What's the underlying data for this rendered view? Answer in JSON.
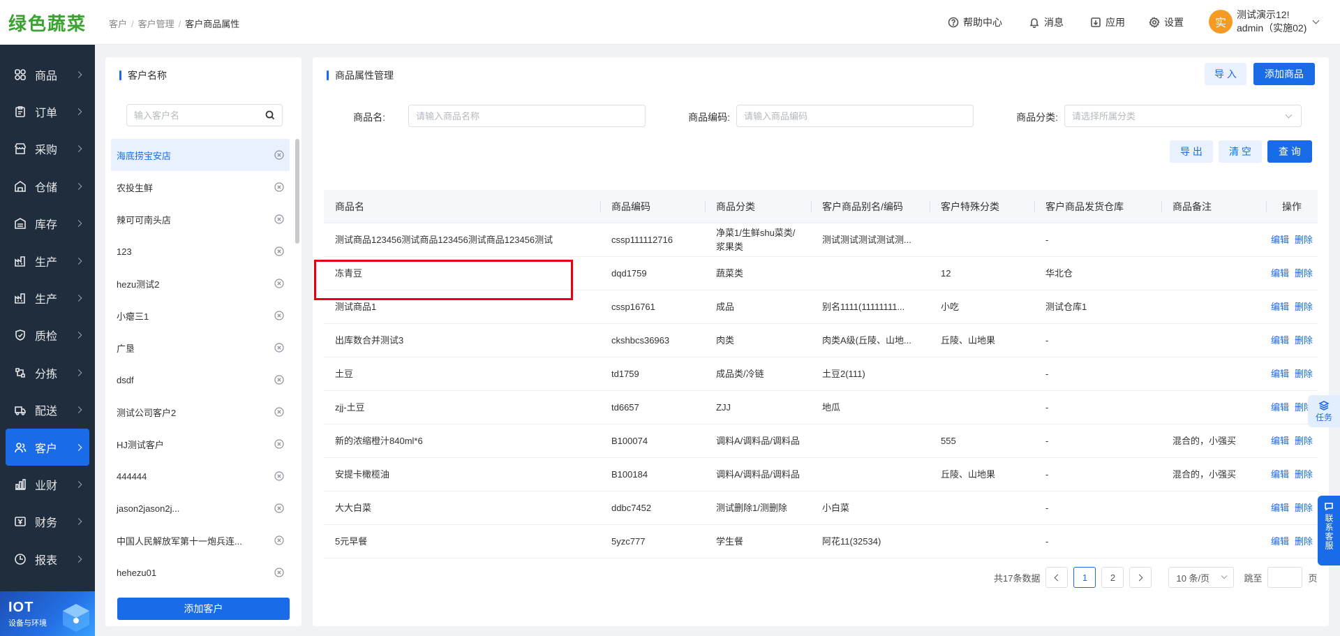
{
  "logo": {
    "text": "绿色蔬菜"
  },
  "sidebar": {
    "items": [
      {
        "label": "商品",
        "icon": "grid-icon"
      },
      {
        "label": "订单",
        "icon": "clipboard-icon"
      },
      {
        "label": "采购",
        "icon": "shop-icon"
      },
      {
        "label": "仓储",
        "icon": "warehouse-icon"
      },
      {
        "label": "库存",
        "icon": "inventory-icon"
      },
      {
        "label": "生产",
        "icon": "factory-icon"
      },
      {
        "label": "生产",
        "icon": "factory-icon"
      },
      {
        "label": "质检",
        "icon": "shield-icon"
      },
      {
        "label": "分拣",
        "icon": "sort-icon"
      },
      {
        "label": "配送",
        "icon": "truck-icon"
      },
      {
        "label": "客户",
        "icon": "user-icon"
      },
      {
        "label": "业财",
        "icon": "finance-icon"
      },
      {
        "label": "财务",
        "icon": "money-icon"
      },
      {
        "label": "报表",
        "icon": "report-icon"
      }
    ],
    "active_index": 10,
    "iot": {
      "title": "IOT",
      "subtitle": "设备与环境"
    }
  },
  "header": {
    "breadcrumb": [
      "客户",
      "客户管理",
      "客户商品属性"
    ],
    "help": "帮助中心",
    "messages": "消息",
    "apps": "应用",
    "settings": "设置",
    "avatar_char": "实",
    "user_name": "测试演示12!",
    "user_account": "admin（实施02)"
  },
  "customer_panel": {
    "title": "客户名称",
    "search_placeholder": "输入客户名",
    "customers": [
      "海底捞宝安店",
      "农投生鲜",
      "辣可可南头店",
      "123",
      "hezu测试2",
      "小瘪三1",
      "广垦",
      "dsdf",
      "测试公司客户2",
      "HJ测试客户",
      "444444",
      "jason2jason2j...",
      "中国人民解放军第十一炮兵连...",
      "hehezu01"
    ],
    "selected_index": 0,
    "add_button": "添加客户"
  },
  "main": {
    "title": "商品属性管理",
    "import_button": "导 入",
    "add_product_button": "添加商品",
    "filters": {
      "name_label": "商品名:",
      "name_placeholder": "请输入商品名称",
      "code_label": "商品编码:",
      "code_placeholder": "请输入商品编码",
      "category_label": "商品分类:",
      "category_placeholder": "请选择所属分类"
    },
    "export_button": "导 出",
    "clear_button": "清 空",
    "query_button": "查 询",
    "table": {
      "columns": [
        "商品名",
        "商品编码",
        "商品分类",
        "客户商品别名/编码",
        "客户特殊分类",
        "客户商品发货仓库",
        "商品备注",
        "操作"
      ],
      "edit_label": "编辑",
      "delete_label": "删除",
      "rows": [
        [
          "测试商品123456测试商品123456测试商品123456测试",
          "cssp111112716",
          "净菜1/生鲜shu菜类/浆果类",
          "测试测试测试测试测...",
          "",
          "-",
          ""
        ],
        [
          "冻青豆",
          "dqd1759",
          "蔬菜类",
          "",
          "12",
          "华北仓",
          ""
        ],
        [
          "测试商品1",
          "cssp16761",
          "成品",
          "别名1111(11111111...",
          "小吃",
          "测试仓库1",
          ""
        ],
        [
          "出库数合并测试3",
          "ckshbcs36963",
          "肉类",
          "肉类A级(丘陵、山地...",
          "丘陵、山地果",
          "-",
          ""
        ],
        [
          "土豆",
          "td1759",
          "成品类/冷链",
          "土豆2(111)",
          "",
          "-",
          ""
        ],
        [
          "zjj-土豆",
          "td6657",
          "ZJJ",
          "地瓜",
          "",
          "-",
          ""
        ],
        [
          "新的浓缩橙汁840ml*6",
          "B100074",
          "调料A/调料品/调料品",
          "",
          "555",
          "-",
          "混合的，小强买"
        ],
        [
          "安提卡橄榄油",
          "B100184",
          "调料A/调料品/调料品",
          "",
          "丘陵、山地果",
          "-",
          "混合的，小强买"
        ],
        [
          "大大白菜",
          "ddbc7452",
          "测试删除1/测删除",
          "小白菜",
          "",
          "-",
          ""
        ],
        [
          "5元早餐",
          "5yzc777",
          "学生餐",
          "阿花11(32534)",
          "",
          "-",
          ""
        ]
      ]
    },
    "pagination": {
      "total_text": "共17条数据",
      "pages": [
        "1",
        "2"
      ],
      "current_page": "1",
      "page_size": "10 条/页",
      "jump_label": "跳至",
      "page_unit": "页"
    }
  },
  "float": {
    "task_label": "任务",
    "service_label": "联系客服"
  }
}
